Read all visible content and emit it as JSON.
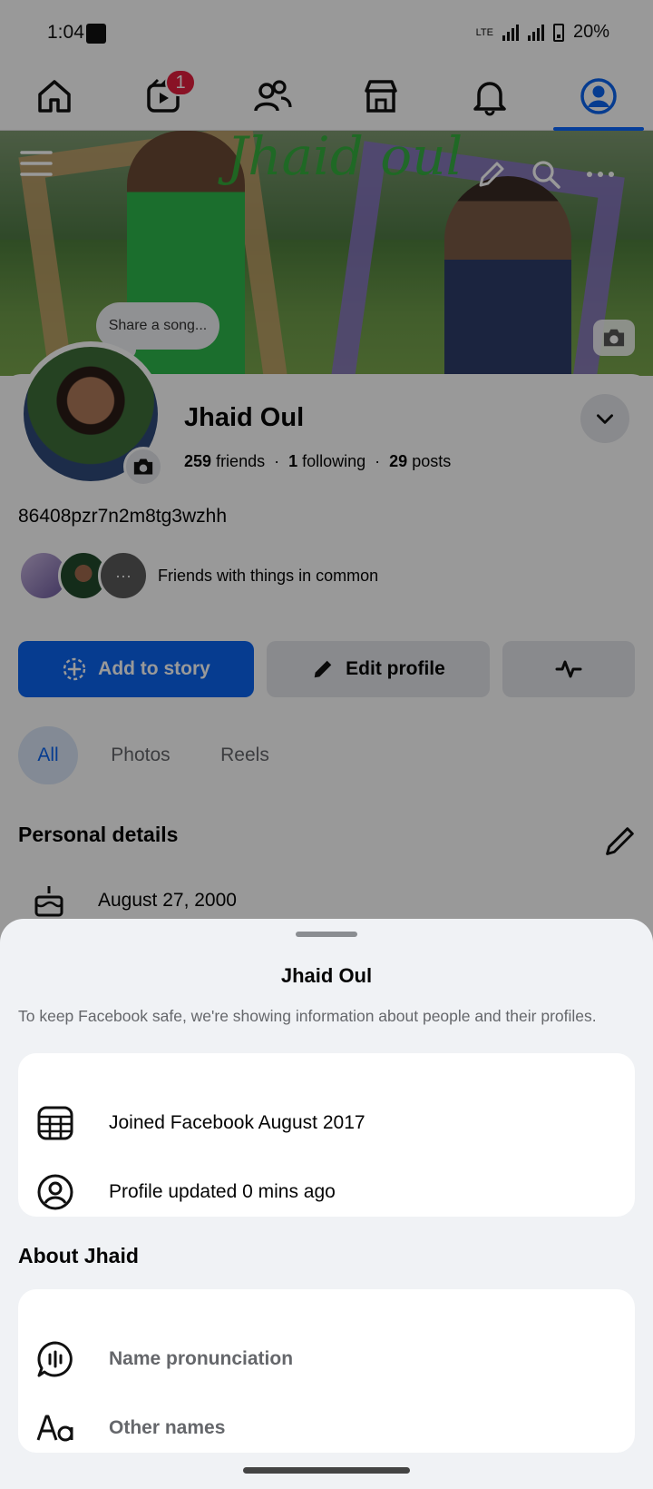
{
  "status_bar": {
    "time": "1:04",
    "network": "LTE",
    "battery": "20%"
  },
  "nav": {
    "tabs": [
      "home",
      "video",
      "friends",
      "marketplace",
      "notifications",
      "profile"
    ],
    "video_badge": "1",
    "active_tab": "profile"
  },
  "cover": {
    "title": "Jhaid oul",
    "song_prompt": "Share a song..."
  },
  "profile": {
    "name": "Jhaid Oul",
    "friends_count": "259",
    "friends_label": "friends",
    "following_count": "1",
    "following_label": "following",
    "posts_count": "29",
    "posts_label": "posts",
    "username": "86408pzr7n2m8tg3wzhh",
    "mutual_text": "Friends with things in common"
  },
  "actions": {
    "add_story": "Add to story",
    "edit_profile": "Edit profile"
  },
  "filters": [
    "All",
    "Photos",
    "Reels"
  ],
  "details": {
    "title": "Personal details",
    "birthday": "August 27, 2000"
  },
  "sheet": {
    "title": "Jhaid Oul",
    "description": "To keep Facebook safe, we're showing information about people and their profiles.",
    "info_rows": [
      "Joined Facebook August 2017",
      "Profile updated 0 mins ago"
    ],
    "about_title": "About Jhaid",
    "about_rows": [
      "Name pronunciation",
      "Other names"
    ]
  },
  "colors": {
    "accent": "#0a64f0",
    "badge": "#e41e3f",
    "sheet_bg": "#f0f2f5"
  }
}
